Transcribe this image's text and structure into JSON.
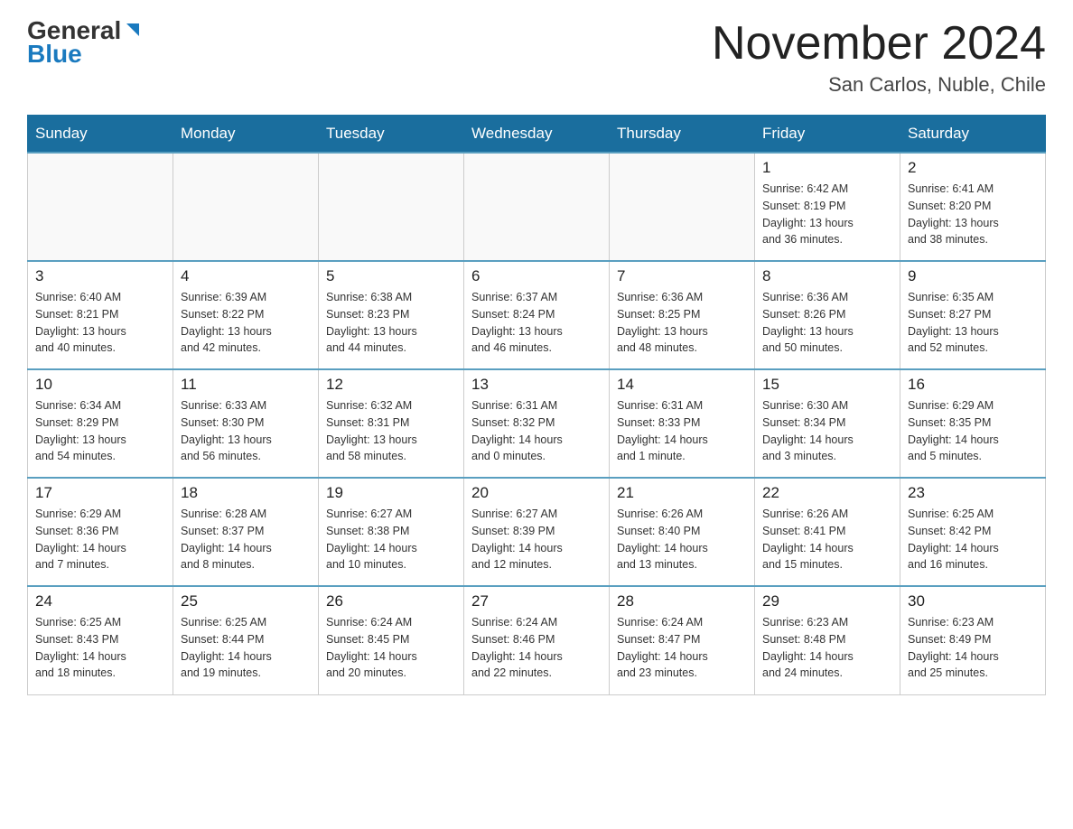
{
  "header": {
    "logo_part1": "General",
    "logo_part2": "Blue",
    "month_title": "November 2024",
    "location": "San Carlos, Nuble, Chile"
  },
  "days_of_week": [
    "Sunday",
    "Monday",
    "Tuesday",
    "Wednesday",
    "Thursday",
    "Friday",
    "Saturday"
  ],
  "weeks": [
    [
      {
        "day": "",
        "info": ""
      },
      {
        "day": "",
        "info": ""
      },
      {
        "day": "",
        "info": ""
      },
      {
        "day": "",
        "info": ""
      },
      {
        "day": "",
        "info": ""
      },
      {
        "day": "1",
        "info": "Sunrise: 6:42 AM\nSunset: 8:19 PM\nDaylight: 13 hours\nand 36 minutes."
      },
      {
        "day": "2",
        "info": "Sunrise: 6:41 AM\nSunset: 8:20 PM\nDaylight: 13 hours\nand 38 minutes."
      }
    ],
    [
      {
        "day": "3",
        "info": "Sunrise: 6:40 AM\nSunset: 8:21 PM\nDaylight: 13 hours\nand 40 minutes."
      },
      {
        "day": "4",
        "info": "Sunrise: 6:39 AM\nSunset: 8:22 PM\nDaylight: 13 hours\nand 42 minutes."
      },
      {
        "day": "5",
        "info": "Sunrise: 6:38 AM\nSunset: 8:23 PM\nDaylight: 13 hours\nand 44 minutes."
      },
      {
        "day": "6",
        "info": "Sunrise: 6:37 AM\nSunset: 8:24 PM\nDaylight: 13 hours\nand 46 minutes."
      },
      {
        "day": "7",
        "info": "Sunrise: 6:36 AM\nSunset: 8:25 PM\nDaylight: 13 hours\nand 48 minutes."
      },
      {
        "day": "8",
        "info": "Sunrise: 6:36 AM\nSunset: 8:26 PM\nDaylight: 13 hours\nand 50 minutes."
      },
      {
        "day": "9",
        "info": "Sunrise: 6:35 AM\nSunset: 8:27 PM\nDaylight: 13 hours\nand 52 minutes."
      }
    ],
    [
      {
        "day": "10",
        "info": "Sunrise: 6:34 AM\nSunset: 8:29 PM\nDaylight: 13 hours\nand 54 minutes."
      },
      {
        "day": "11",
        "info": "Sunrise: 6:33 AM\nSunset: 8:30 PM\nDaylight: 13 hours\nand 56 minutes."
      },
      {
        "day": "12",
        "info": "Sunrise: 6:32 AM\nSunset: 8:31 PM\nDaylight: 13 hours\nand 58 minutes."
      },
      {
        "day": "13",
        "info": "Sunrise: 6:31 AM\nSunset: 8:32 PM\nDaylight: 14 hours\nand 0 minutes."
      },
      {
        "day": "14",
        "info": "Sunrise: 6:31 AM\nSunset: 8:33 PM\nDaylight: 14 hours\nand 1 minute."
      },
      {
        "day": "15",
        "info": "Sunrise: 6:30 AM\nSunset: 8:34 PM\nDaylight: 14 hours\nand 3 minutes."
      },
      {
        "day": "16",
        "info": "Sunrise: 6:29 AM\nSunset: 8:35 PM\nDaylight: 14 hours\nand 5 minutes."
      }
    ],
    [
      {
        "day": "17",
        "info": "Sunrise: 6:29 AM\nSunset: 8:36 PM\nDaylight: 14 hours\nand 7 minutes."
      },
      {
        "day": "18",
        "info": "Sunrise: 6:28 AM\nSunset: 8:37 PM\nDaylight: 14 hours\nand 8 minutes."
      },
      {
        "day": "19",
        "info": "Sunrise: 6:27 AM\nSunset: 8:38 PM\nDaylight: 14 hours\nand 10 minutes."
      },
      {
        "day": "20",
        "info": "Sunrise: 6:27 AM\nSunset: 8:39 PM\nDaylight: 14 hours\nand 12 minutes."
      },
      {
        "day": "21",
        "info": "Sunrise: 6:26 AM\nSunset: 8:40 PM\nDaylight: 14 hours\nand 13 minutes."
      },
      {
        "day": "22",
        "info": "Sunrise: 6:26 AM\nSunset: 8:41 PM\nDaylight: 14 hours\nand 15 minutes."
      },
      {
        "day": "23",
        "info": "Sunrise: 6:25 AM\nSunset: 8:42 PM\nDaylight: 14 hours\nand 16 minutes."
      }
    ],
    [
      {
        "day": "24",
        "info": "Sunrise: 6:25 AM\nSunset: 8:43 PM\nDaylight: 14 hours\nand 18 minutes."
      },
      {
        "day": "25",
        "info": "Sunrise: 6:25 AM\nSunset: 8:44 PM\nDaylight: 14 hours\nand 19 minutes."
      },
      {
        "day": "26",
        "info": "Sunrise: 6:24 AM\nSunset: 8:45 PM\nDaylight: 14 hours\nand 20 minutes."
      },
      {
        "day": "27",
        "info": "Sunrise: 6:24 AM\nSunset: 8:46 PM\nDaylight: 14 hours\nand 22 minutes."
      },
      {
        "day": "28",
        "info": "Sunrise: 6:24 AM\nSunset: 8:47 PM\nDaylight: 14 hours\nand 23 minutes."
      },
      {
        "day": "29",
        "info": "Sunrise: 6:23 AM\nSunset: 8:48 PM\nDaylight: 14 hours\nand 24 minutes."
      },
      {
        "day": "30",
        "info": "Sunrise: 6:23 AM\nSunset: 8:49 PM\nDaylight: 14 hours\nand 25 minutes."
      }
    ]
  ]
}
